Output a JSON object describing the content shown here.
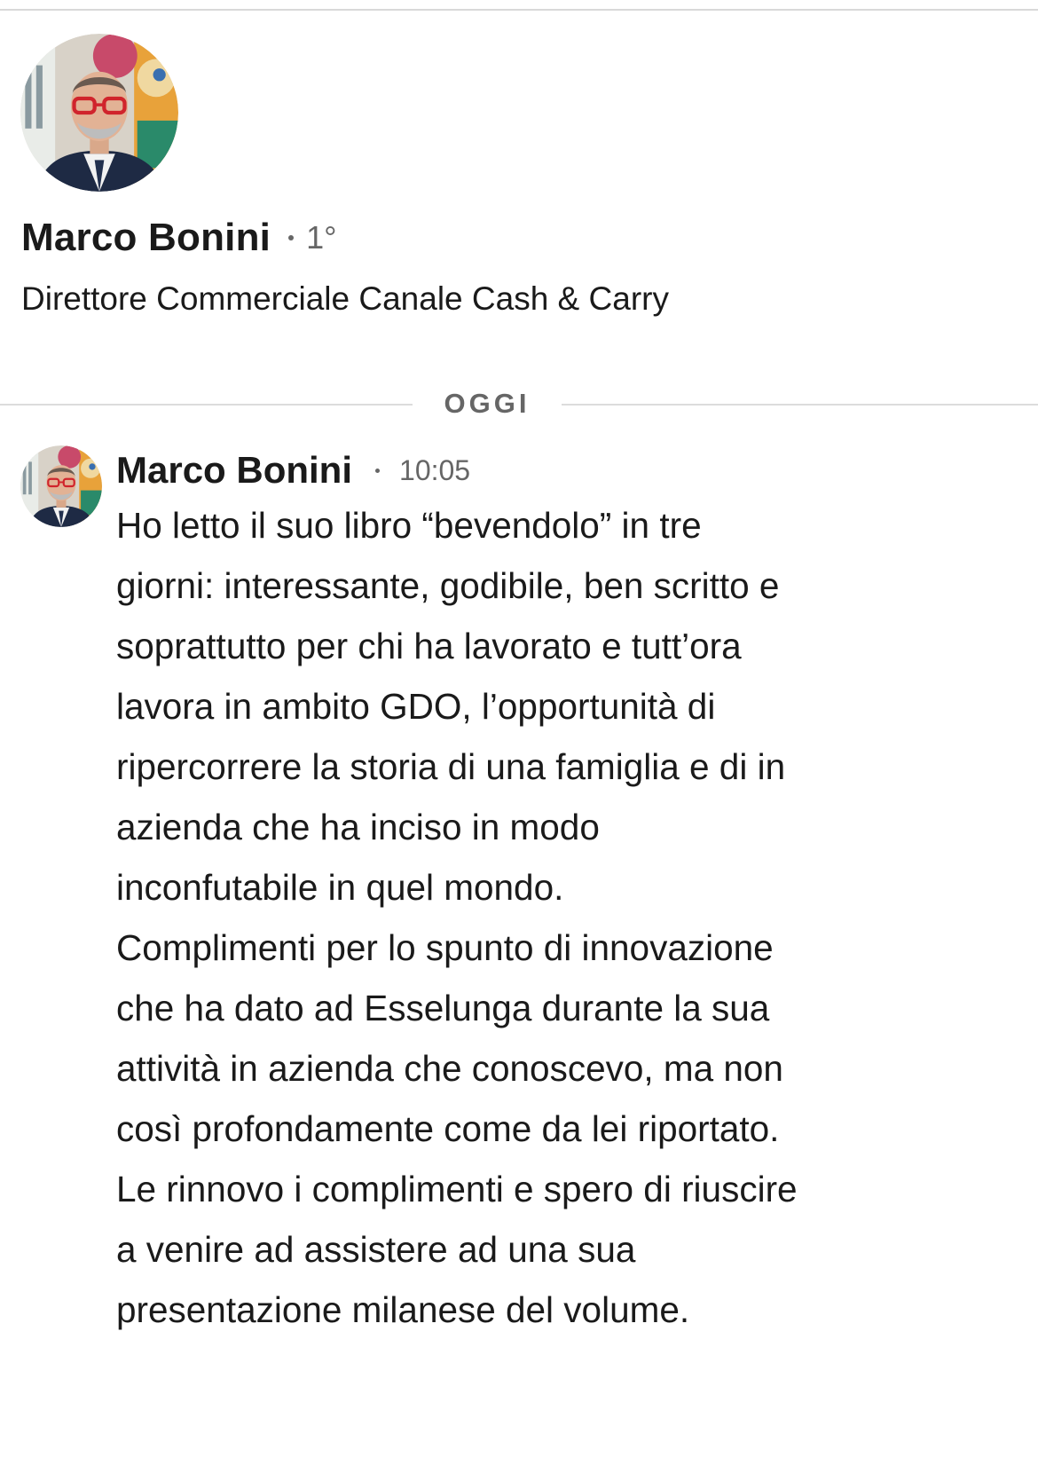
{
  "profile": {
    "name": "Marco Bonini",
    "connection_degree": "1°",
    "headline": "Direttore Commerciale Canale Cash & Carry",
    "avatar_icon": "profile-photo"
  },
  "conversation": {
    "day_label": "OGGI",
    "messages": [
      {
        "sender": "Marco Bonini",
        "time": "10:05",
        "avatar_icon": "profile-photo",
        "lines": [
          "Ho letto il suo libro “bevendolo” in tre",
          "giorni: interessante, godibile, ben scritto e",
          "soprattutto per chi ha lavorato e tutt’ora",
          "lavora in ambito GDO, l’opportunità di",
          "ripercorrere la storia di una famiglia e di in",
          "azienda che ha inciso in modo",
          "inconfutabile in quel mondo.",
          "Complimenti per lo spunto di innovazione",
          "che ha dato ad Esselunga durante la sua",
          "attività in azienda che conoscevo, ma non",
          "così profondamente come da lei riportato.",
          "Le rinnovo i complimenti e spero di riuscire",
          "a venire ad assistere ad una sua",
          "presentazione milanese del volume."
        ]
      }
    ]
  },
  "colors": {
    "text_primary": "#1a1a1a",
    "text_secondary": "#666666",
    "divider": "#dcdcdc",
    "background": "#ffffff"
  }
}
